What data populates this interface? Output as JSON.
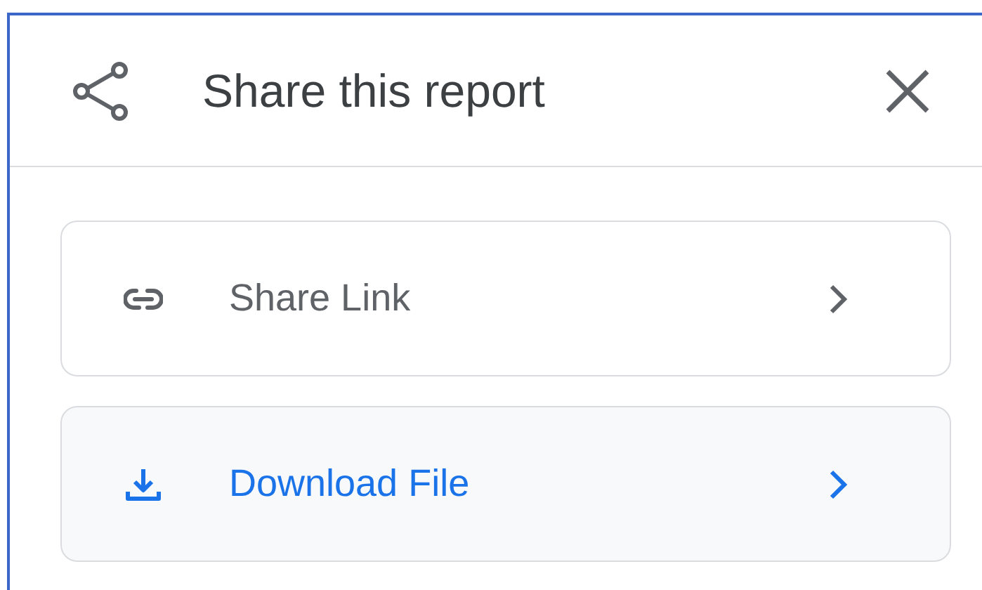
{
  "dialog": {
    "title": "Share this report"
  },
  "options": [
    {
      "kind": "link",
      "label": "Share Link",
      "selected": false
    },
    {
      "kind": "download",
      "label": "Download File",
      "selected": true
    }
  ]
}
